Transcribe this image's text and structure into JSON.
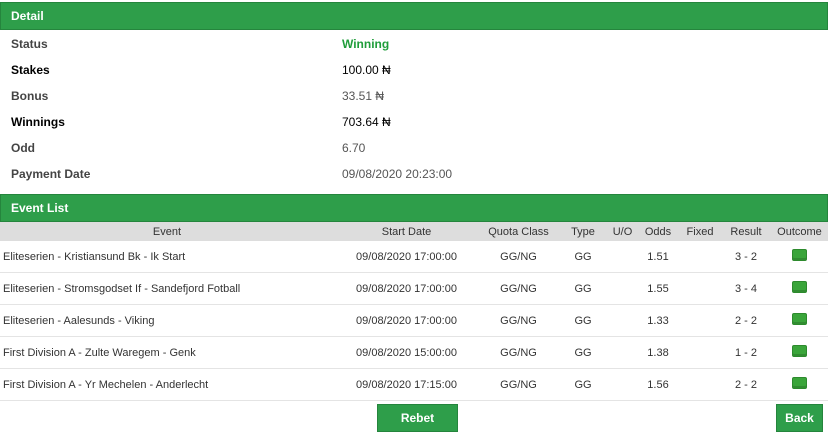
{
  "detail": {
    "header": "Detail",
    "rows": [
      {
        "label": "Status",
        "value": "Winning"
      },
      {
        "label": "Stakes",
        "value": "100.00 ₦"
      },
      {
        "label": "Bonus",
        "value": "33.51 ₦"
      },
      {
        "label": "Winnings",
        "value": "703.64 ₦"
      },
      {
        "label": "Odd",
        "value": "6.70"
      },
      {
        "label": "Payment Date",
        "value": "09/08/2020 20:23:00"
      }
    ]
  },
  "event_list": {
    "header": "Event List",
    "columns": [
      "Event",
      "Start Date",
      "Quota Class",
      "Type",
      "U/O",
      "Odds",
      "Fixed",
      "Result",
      "Outcome"
    ],
    "rows": [
      {
        "event": "Eliteserien - Kristiansund Bk - Ik Start",
        "start_date": "09/08/2020 17:00:00",
        "quota_class": "GG/NG",
        "type": "GG",
        "uo": "",
        "odds": "1.51",
        "fixed": "",
        "result": "3 - 2",
        "outcome": "won"
      },
      {
        "event": "Eliteserien - Stromsgodset If - Sandefjord Fotball",
        "start_date": "09/08/2020 17:00:00",
        "quota_class": "GG/NG",
        "type": "GG",
        "uo": "",
        "odds": "1.55",
        "fixed": "",
        "result": "3 - 4",
        "outcome": "won"
      },
      {
        "event": "Eliteserien - Aalesunds - Viking",
        "start_date": "09/08/2020 17:00:00",
        "quota_class": "GG/NG",
        "type": "GG",
        "uo": "",
        "odds": "1.33",
        "fixed": "",
        "result": "2 - 2",
        "outcome": "won"
      },
      {
        "event": "First Division A - Zulte Waregem - Genk",
        "start_date": "09/08/2020 15:00:00",
        "quota_class": "GG/NG",
        "type": "GG",
        "uo": "",
        "odds": "1.38",
        "fixed": "",
        "result": "1 - 2",
        "outcome": "won"
      },
      {
        "event": "First Division A - Yr Mechelen - Anderlecht",
        "start_date": "09/08/2020 17:15:00",
        "quota_class": "GG/NG",
        "type": "GG",
        "uo": "",
        "odds": "1.56",
        "fixed": "",
        "result": "2 - 2",
        "outcome": "won"
      }
    ]
  },
  "buttons": {
    "rebet": "Rebet",
    "back": "Back"
  },
  "colors": {
    "header_green": "#2e9e4a",
    "status_green": "#1f9d3a",
    "outcome_green": "#3aa53a"
  },
  "icons": {
    "outcome": "green-square-icon"
  }
}
